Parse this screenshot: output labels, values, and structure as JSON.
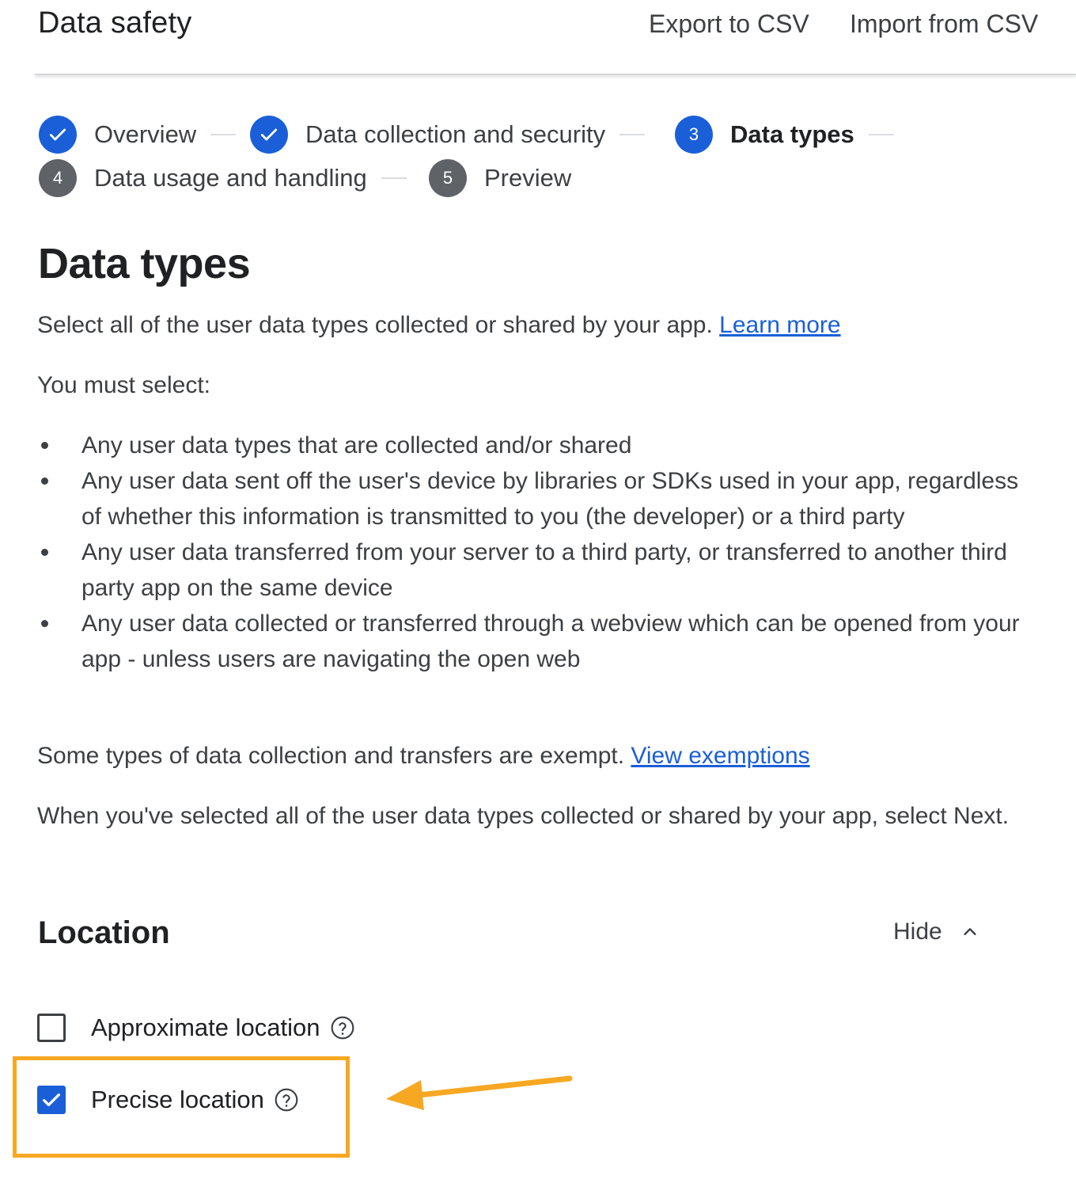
{
  "header": {
    "title": "Data safety",
    "export_label": "Export to CSV",
    "import_label": "Import from CSV"
  },
  "steps": [
    {
      "number": "1",
      "label": "Overview",
      "state": "done"
    },
    {
      "number": "2",
      "label": "Data collection and security",
      "state": "done"
    },
    {
      "number": "3",
      "label": "Data types",
      "state": "active"
    },
    {
      "number": "4",
      "label": "Data usage and handling",
      "state": "todo"
    },
    {
      "number": "5",
      "label": "Preview",
      "state": "todo"
    }
  ],
  "main": {
    "title": "Data types",
    "intro": "Select all of the user data types collected or shared by your app. ",
    "learn_more": "Learn more",
    "must_select": "You must select:",
    "bullets": [
      "Any user data types that are collected and/or shared",
      "Any user data sent off the user's device by libraries or SDKs used in your app, regardless of whether this information is transmitted to you (the developer) or a third party",
      "Any user data transferred from your server to a third party, or transferred to another third party app on the same device",
      "Any user data collected or transferred through a webview which can be opened from your app - unless users are navigating the open web"
    ],
    "exempt": "Some types of data collection and transfers are exempt. ",
    "view_exemptions": "View exemptions",
    "next_note": "When you've selected all of the user data types collected or shared by your app, select Next."
  },
  "location": {
    "title": "Location",
    "hide_label": "Hide",
    "options": [
      {
        "label": "Approximate location",
        "checked": false
      },
      {
        "label": "Precise location",
        "checked": true
      }
    ]
  },
  "colors": {
    "accent": "#1a5fd8",
    "highlight": "#f7a823"
  },
  "icons": [
    "check-icon",
    "chevron-up-icon",
    "help-icon",
    "arrow-left-icon"
  ]
}
